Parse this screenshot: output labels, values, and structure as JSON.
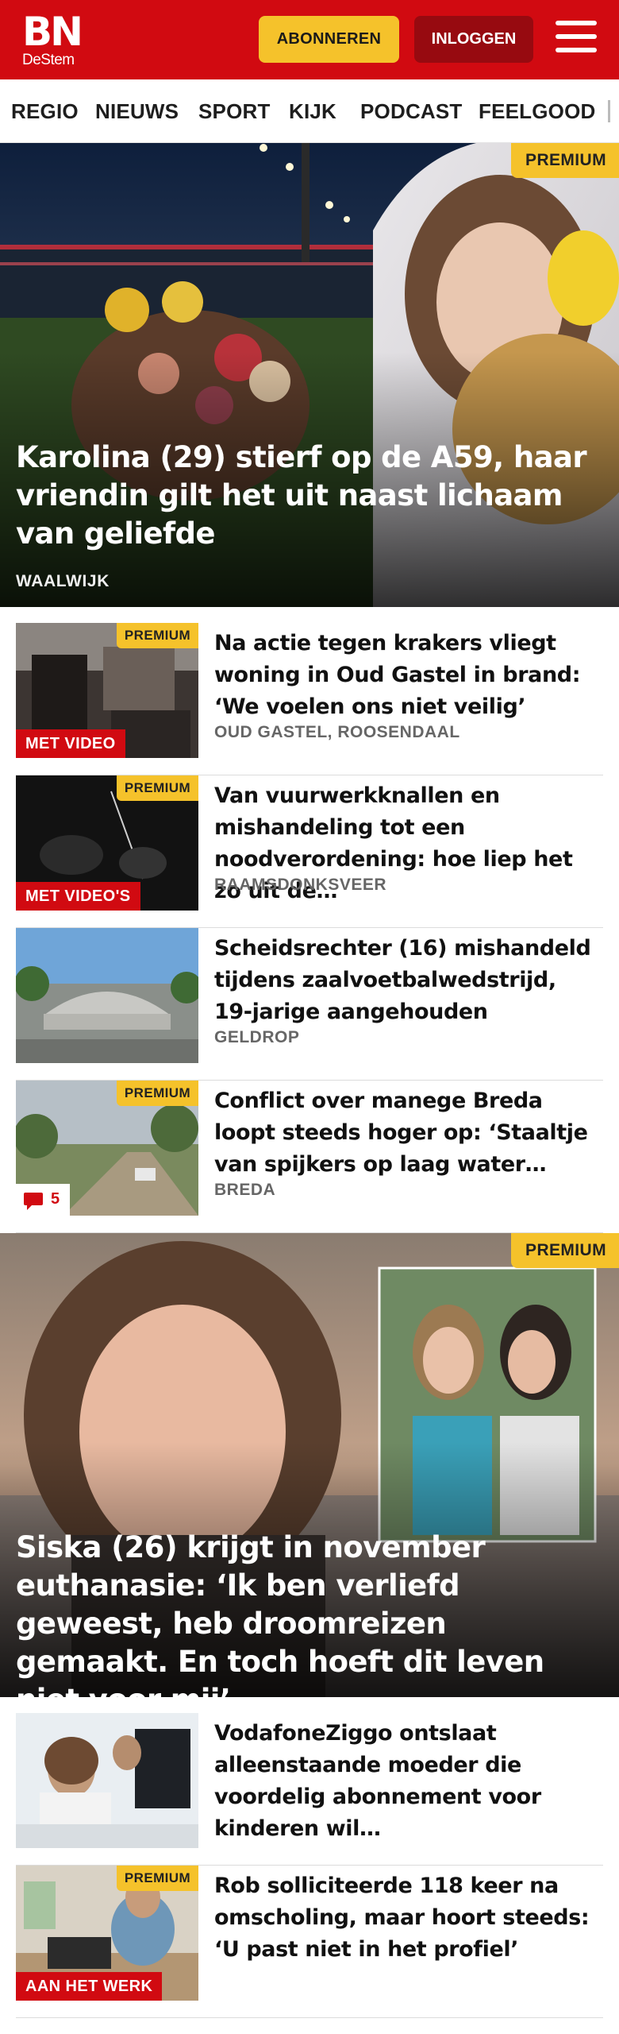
{
  "header": {
    "logo_main": "BN",
    "logo_sub": "DeStem",
    "subscribe_label": "ABONNEREN",
    "login_label": "INLOGGEN",
    "menu_icon": "hamburger-menu-icon",
    "brand_color": "#d10a11",
    "accent_color": "#f5c22b"
  },
  "nav": {
    "items": [
      {
        "label": "REGIO"
      },
      {
        "label": "NIEUWS"
      },
      {
        "label": "SPORT"
      },
      {
        "label": "KIJK"
      },
      {
        "label": "PODCAST"
      },
      {
        "label": "FEELGOOD"
      }
    ]
  },
  "hero1": {
    "badge": "PREMIUM",
    "title": "Karolina (29) stierf op de A59, haar vriendin gilt het uit naast lichaam van geliefde",
    "location": "WAALWIJK"
  },
  "articles": [
    {
      "title": "Na actie tegen krakers vliegt woning in Oud Gastel in brand: ‘We voelen ons niet veilig’",
      "location": "OUD GASTEL, ROOSENDAAL",
      "badge": "PREMIUM",
      "tag": "MET VIDEO"
    },
    {
      "title": "Van vuurwerkknallen en mishandeling tot een noodverordening: hoe liep het zo uit de…",
      "location": "RAAMSDONKSVEER",
      "badge": "PREMIUM",
      "tag": "MET VIDEO'S"
    },
    {
      "title": "Scheidsrechter (16) mishandeld tijdens zaalvoetbalwedstrijd, 19-jarige aangehouden",
      "location": "GELDROP"
    },
    {
      "title": "Conflict over manege Breda loopt steeds hoger op: ‘Staaltje van spijkers op laag water…",
      "location": "BREDA",
      "badge": "PREMIUM",
      "comments": "5",
      "comment_icon": "comment-icon"
    }
  ],
  "hero2": {
    "badge": "PREMIUM",
    "title": "Siska (26) krijgt in november euthanasie: ‘Ik ben verliefd geweest, heb droomreizen gemaakt. En toch hoeft dit leven niet voor mij’"
  },
  "articles2": [
    {
      "title": "VodafoneZiggo ontslaat alleenstaande moeder die voordelig abonnement voor kinderen wil…"
    },
    {
      "title": "Rob solliciteerde 118 keer na omscholing, maar hoort steeds: ‘U past niet in het profiel’",
      "badge": "PREMIUM",
      "tag": "AAN HET WERK"
    }
  ]
}
